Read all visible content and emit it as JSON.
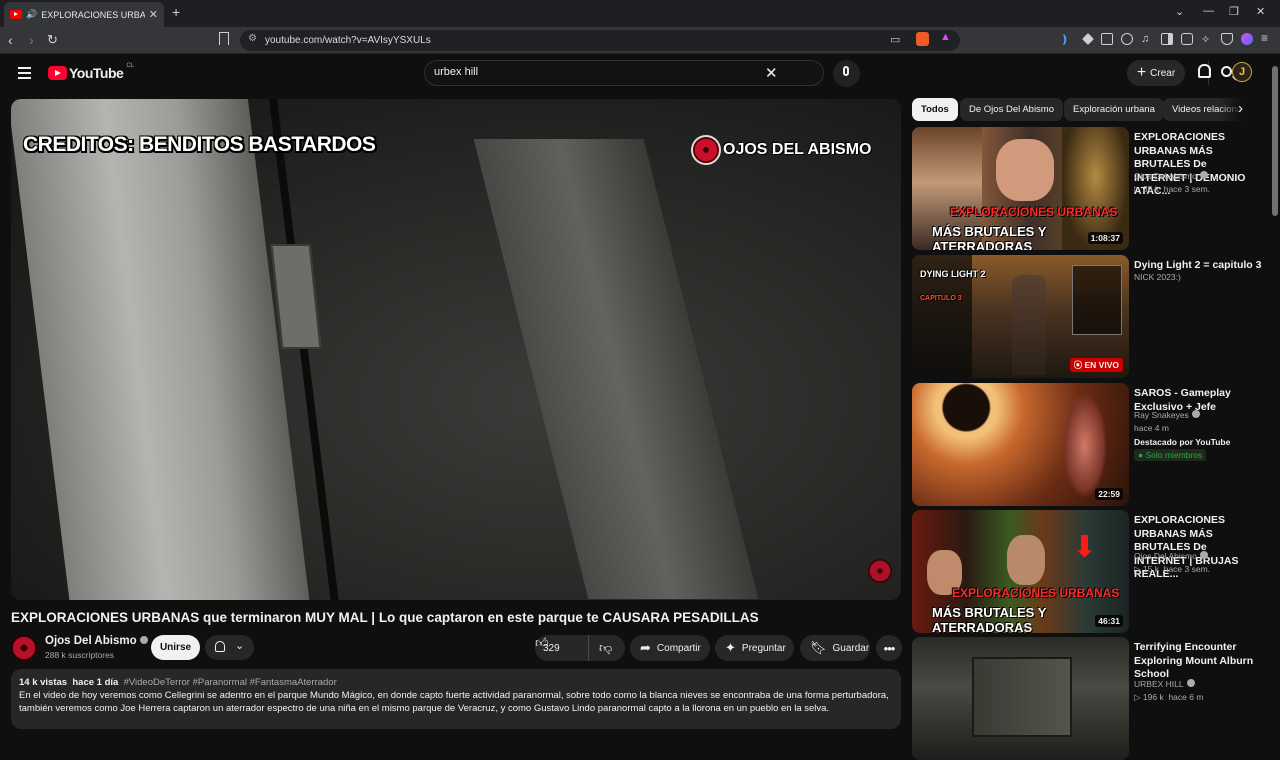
{
  "browser": {
    "tab_title": "EXPLORACIONES URBANAS q",
    "url": "youtube.com/watch?v=AVIsyYSXULs",
    "new_tab": "+",
    "tab_close": "✕"
  },
  "header": {
    "logo_text": "YouTube",
    "country_code": "CL",
    "search_value": "urbex hill",
    "create_label": "Crear",
    "avatar_letter": "J"
  },
  "video": {
    "watermark_left": "CREDITOS: BENDITOS BASTARDOS",
    "watermark_right": "OJOS DEL ABISMO",
    "title": "EXPLORACIONES URBANAS que terminaron MUY MAL | Lo que captaron en este parque te CAUSARA PESADILLAS"
  },
  "channel": {
    "name": "Ojos Del Abismo",
    "subscribers": "288 k suscriptores",
    "join_label": "Unirse"
  },
  "actions": {
    "likes": "329",
    "share": "Compartir",
    "ask": "Preguntar",
    "save": "Guardar"
  },
  "description": {
    "views": "14 k vistas",
    "date": "hace 1 día",
    "tags": "#VideoDeTerror #Paranormal #FantasmaAterrador",
    "line1": "En el video de hoy veremos como Cellegrini se adentro en el parque Mundo Mágico, en donde capto fuerte actividad paranormal, sobre todo como la blanca nieves se encontraba de una forma perturbadora,",
    "line2": "también veremos como Joe Herrera captaron un aterrador espectro de una niña en el mismo parque de Veracruz, y como Gustavo Lindo paranormal capto a la llorona en un pueblo en la selva."
  },
  "chips": [
    "Todos",
    "De Ojos Del Abismo",
    "Exploración urbana",
    "Videos relacionados"
  ],
  "recommendations": [
    {
      "title": "EXPLORACIONES URBANAS MÁS BRUTALES De INTERNET | DEMONIO ATAC...",
      "channel": "Ojos Del Abismo",
      "views": "35 k",
      "age": "hace 3 sem.",
      "duration": "1:08:37",
      "thumb_line1": "EXPLORACIONES URBANAS",
      "thumb_line2": "MÁS BRUTALES Y ATERRADORAS"
    },
    {
      "title": "Dying Light 2 = capitulo 3",
      "channel": "NICK 2023:)",
      "badge": "EN VIVO",
      "thumb_line1": "DYING LIGHT 2",
      "thumb_line2": "CAPITULO 3"
    },
    {
      "title": "SAROS - Gameplay Exclusivo + Jefe",
      "channel": "Ray Snakeyes",
      "age": "hace 4 m",
      "promo": "Destacado por YouTube",
      "members": "Solo miembros",
      "duration": "22:59"
    },
    {
      "title": "EXPLORACIONES URBANAS MÁS BRUTALES De INTERNET | BRUJAS REALE...",
      "channel": "Ojos Del Abismo",
      "views": "15 k",
      "age": "hace 3 sem.",
      "duration": "46:31",
      "thumb_line1": "EXPLORACIONES URBANAS",
      "thumb_line2": "MÁS BRUTALES Y ATERRADORAS"
    },
    {
      "title": "Terrifying Encounter Exploring Mount Alburn School",
      "channel": "URBEX HILL",
      "views": "196 k",
      "age": "hace 6 m"
    }
  ]
}
